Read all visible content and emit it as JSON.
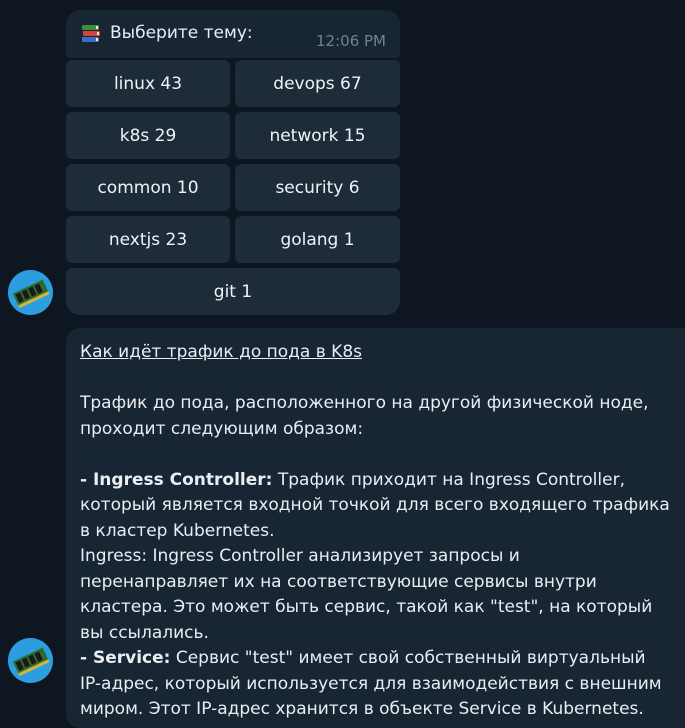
{
  "top_message": {
    "icon": "books-icon",
    "text": "Выберите тему:",
    "time": "12:06 PM"
  },
  "keyboard": {
    "buttons": [
      "linux 43",
      "devops 67",
      "k8s 29",
      "network 15",
      "common 10",
      "security 6",
      "nextjs 23",
      "golang 1",
      "git 1"
    ]
  },
  "main_message": {
    "heading": "Как идёт трафик до пода в K8s",
    "intro_line1": "Трафик до пода, расположенного на другой физической ноде,",
    "intro_line2": "проходит следующим образом:",
    "item1_bold": "- Ingress Controller:",
    "item1_text": " Трафик приходит на Ingress Controller, который является входной точкой для всего входящего трафика в кластер Kubernetes.",
    "item2_text": "Ingress: Ingress Controller анализирует запросы и перенаправляет их на соответствующие сервисы внутри кластера. Это может быть сервис, такой как \"test\", на который вы ссылались.",
    "item3_bold": "- Service:",
    "item3_text": " Сервис \"test\" имеет свой собственный виртуальный IP-адрес, который используется для взаимодействия с внешним миром. Этот IP-адрес хранится в объекте Service в Kubernetes."
  },
  "colors": {
    "background": "#0e1621",
    "bubble": "#182533",
    "button": "#1e2c3a",
    "avatar": "#2b9ee0"
  }
}
